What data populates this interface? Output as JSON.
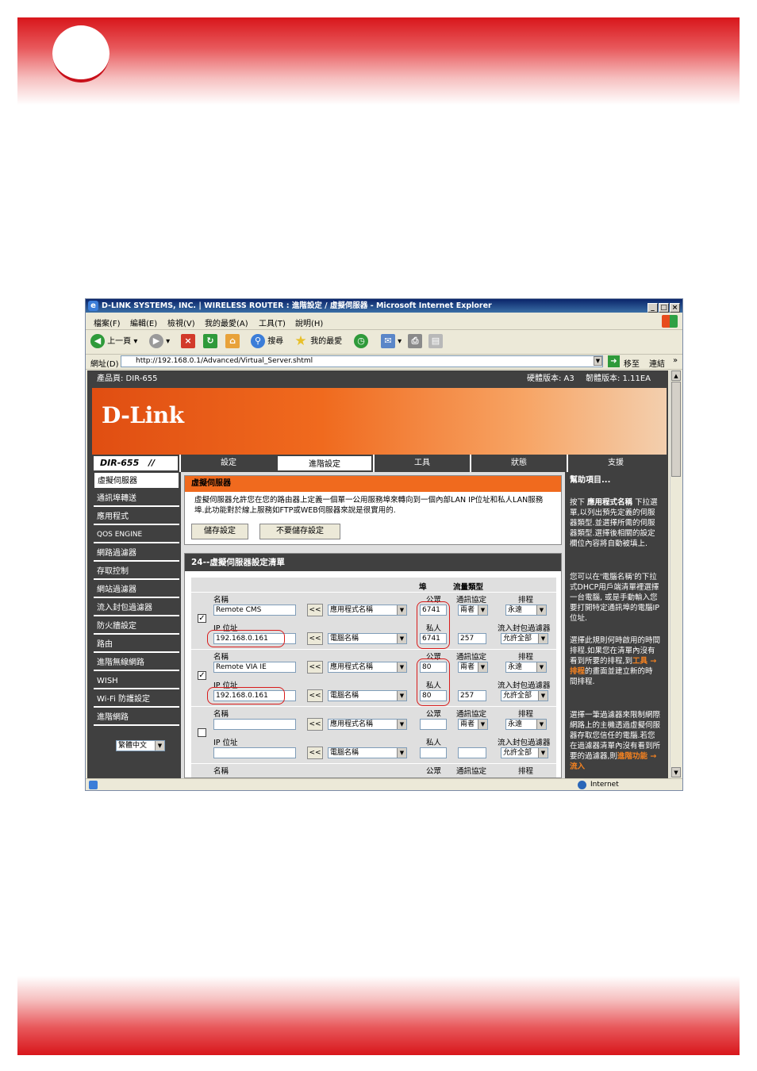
{
  "window": {
    "title": "D-LINK SYSTEMS, INC. | WIRELESS ROUTER : 進階設定 / 虛擬伺服器 - Microsoft Internet Explorer",
    "min": "_",
    "max": "□",
    "close": "×"
  },
  "menu": [
    "檔案(F)",
    "編輯(E)",
    "檢視(V)",
    "我的最愛(A)",
    "工具(T)",
    "說明(H)"
  ],
  "toolbar": {
    "back": "上一頁",
    "search": "搜尋",
    "favorites": "我的最愛"
  },
  "address": {
    "label": "網址(D)",
    "url": "http://192.168.0.1/Advanced/Virtual_Server.shtml",
    "go": "移至",
    "links": "連結",
    "more": "»"
  },
  "status": {
    "zone": "Internet"
  },
  "router": {
    "product": "產品頁: DIR-655",
    "hw_version": "硬體版本: A3",
    "fw_version": "韌體版本: 1.11EA",
    "logo": "D-Link",
    "model": "DIR-655",
    "tabs": [
      "設定",
      "進階設定",
      "工具",
      "狀態",
      "支援"
    ],
    "sidebar": [
      "虛擬伺服器",
      "通訊埠轉送",
      "應用程式",
      "QOS ENGINE",
      "網路過濾器",
      "存取控制",
      "網站過濾器",
      "流入封包過濾器",
      "防火牆設定",
      "路由",
      "進階無線網路",
      "WISH",
      "Wi-Fi 防護設定",
      "進階網路"
    ],
    "language": "繁體中文"
  },
  "panel": {
    "title": "虛擬伺服器",
    "description": "虛擬伺服器允許您在您的路由器上定義一個單一公用服務埠來轉向到一個內部LAN IP位址和私人LAN服務埠.此功能對於線上服務如FTP或WEB伺服器來說是很實用的.",
    "save": "儲存設定",
    "nosave": "不要儲存設定"
  },
  "list": {
    "title": "24--虛擬伺服器設定清單",
    "col_port": "埠",
    "col_traffic": "流量類型",
    "lbl_name": "名稱",
    "lbl_ip": "IP 位址",
    "lbl_public": "公眾",
    "lbl_private": "私人",
    "lbl_protocol": "通訊協定",
    "lbl_schedule": "排程",
    "lbl_filter": "流入封包過濾器",
    "arrow": "<<",
    "app_select": "應用程式名稱",
    "pc_select": "電腦名稱",
    "rows": [
      {
        "checked": "✓",
        "name": "Remote CMS",
        "ip": "192.168.0.161",
        "public": "6741",
        "private": "6741",
        "protocol": "兩者",
        "proto_num": "257",
        "schedule": "永遠",
        "filter": "允許全部"
      },
      {
        "checked": "✓",
        "name": "Remote VIA IE",
        "ip": "192.168.0.161",
        "public": "80",
        "private": "80",
        "protocol": "兩者",
        "proto_num": "257",
        "schedule": "永遠",
        "filter": "允許全部"
      },
      {
        "checked": "",
        "name": "",
        "ip": "",
        "public": "",
        "private": "",
        "protocol": "兩者",
        "proto_num": "",
        "schedule": "永遠",
        "filter": "允許全部"
      }
    ]
  },
  "help": {
    "title": "幫助項目...",
    "p1_a": "按下",
    "p1_b": "應用程式名稱",
    "p1_c": "下拉選單,以列出預先定義的伺服器類型.並選擇所需的伺服器類型.選擇後相關的設定欄位內容將自動被填上.",
    "p2": "您可以在'電腦名稱'的下拉式DHCP用戶端清單裡選擇一台電腦, 或是手動輸入您要打開特定通訊埠的電腦IP位址.",
    "p3_a": "選擇此規則何時啟用的時間排程.如果您在清單內沒有看到所要的排程,到",
    "p3_b": "工具 → 排程",
    "p3_c": "的畫面並建立新的時間排程.",
    "p4_a": "選擇一筆過濾器來限制網際網路上的主機透過虛擬伺服器存取您信任的電腦.若您在過濾器清單內沒有看到所要的過濾器,則",
    "p4_b": "進階功能 → 流入"
  }
}
